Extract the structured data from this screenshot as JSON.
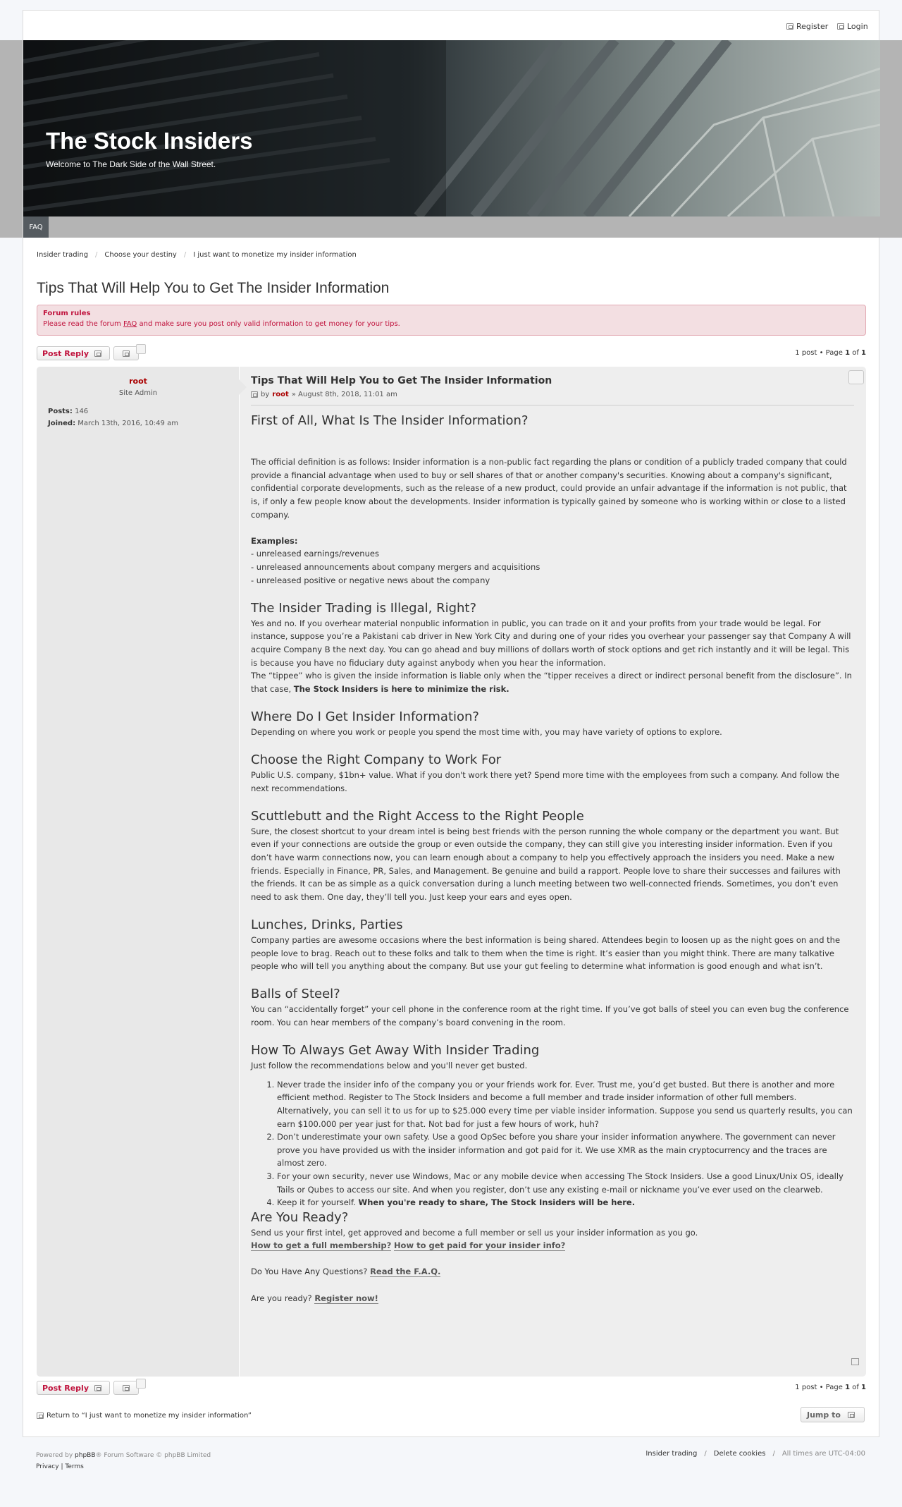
{
  "topbar": {
    "register": "Register",
    "login": "Login"
  },
  "header": {
    "title": "The Stock Insiders",
    "tagline": "Welcome to The Dark Side of the Wall Street."
  },
  "nav": {
    "faq": "FAQ"
  },
  "breadcrumbs": [
    "Insider trading",
    "Choose your destiny",
    "I just want to monetize my insider information"
  ],
  "topic_title": "Tips That Will Help You to Get The Insider Information",
  "rules": {
    "title": "Forum rules",
    "text_before": "Please read the forum ",
    "faq_link": "FAQ",
    "text_after": " and make sure you post only valid information to get money for your tips."
  },
  "actions": {
    "post_reply": "Post Reply",
    "pagination_prefix": "1 post • Page ",
    "page_current": "1",
    "pagination_of": " of ",
    "page_total": "1"
  },
  "profile": {
    "username": "root",
    "rank": "Site Admin",
    "posts_label": "Posts:",
    "posts_value": "146",
    "joined_label": "Joined:",
    "joined_value": "March 13th, 2016, 10:49 am"
  },
  "post": {
    "title": "Tips That Will Help You to Get The Insider Information",
    "meta_by": "by",
    "meta_author": "root",
    "meta_date": "» August 8th, 2018, 11:01 am",
    "h_what": "First of All, What Is The Insider Information?",
    "p_definition": "The official definition is as follows: Insider information is a non-public fact regarding the plans or condition of a publicly traded company that could provide a financial advantage when used to buy or sell shares of that or another company's securities. Knowing about a company's significant, confidential corporate developments, such as the release of a new product, could provide an unfair advantage if the information is not public, that is, if only a few people know about the developments. Insider information is typically gained by someone who is working within or close to a listed company.",
    "examples_label": "Examples:",
    "examples": [
      "- unreleased earnings/revenues",
      "- unreleased announcements about company mergers and acquisitions",
      "- unreleased positive or negative news about the company"
    ],
    "h_illegal": "The Insider Trading is Illegal, Right?",
    "p_illegal": "Yes and no. If you overhear material nonpublic information in public, you can trade on it and your profits from your trade would be legal. For instance, suppose you’re a Pakistani cab driver in New York City and during one of your rides you overhear your passenger say that Company A will acquire Company B the next day. You can go ahead and buy millions of dollars worth of stock options and get rich instantly and it will be legal. This is because you have no fiduciary duty against anybody when you hear the information.",
    "p_tippee": "The “tippee” who is given the inside information is liable only when the “tipper receives a direct or indirect personal benefit from the disclosure”. In that case, ",
    "p_tippee_bold": "The Stock Insiders is here to minimize the risk.",
    "h_where": "Where Do I Get Insider Information?",
    "p_where": "Depending on where you work or people you spend the most time with, you may have variety of options to explore.",
    "h_company": "Choose the Right Company to Work For",
    "p_company": "Public U.S. company, $1bn+ value. What if you don't work there yet? Spend more time with the employees from such a company. And follow the next recommendations.",
    "h_scuttlebutt": "Scuttlebutt and the Right Access to the Right People",
    "p_scuttlebutt": "Sure, the closest shortcut to your dream intel is being best friends with the person running the whole company or the department you want. But even if your connections are outside the group or even outside the company, they can still give you interesting insider information. Even if you don’t have warm connections now, you can learn enough about a company to help you effectively approach the insiders you need. Make a new friends. Especially in Finance, PR, Sales, and Management. Be genuine and build a rapport. People love to share their successes and failures with the friends. It can be as simple as a quick conversation during a lunch meeting between two well-connected friends. Sometimes, you don’t even need to ask them. One day, they’ll tell you. Just keep your ears and eyes open.",
    "h_lunches": "Lunches, Drinks, Parties",
    "p_lunches": "Company parties are awesome occasions where the best information is being shared. Attendees begin to loosen up as the night goes on and the people love to brag. Reach out to these folks and talk to them when the time is right. It’s easier than you might think. There are many talkative people who will tell you anything about the company. But use your gut feeling to determine what information is good enough and what isn’t.",
    "h_steel": "Balls of Steel?",
    "p_steel": "You can “accidentally forget” your cell phone in the conference room at the right time. If you’ve got balls of steel you can even bug the conference room. You can hear members of the company’s board convening in the room.",
    "h_away": "How To Always Get Away With Insider Trading",
    "p_away": "Just follow the recommendations below and you'll never get busted.",
    "list1": "Never trade the insider info of the company you or your friends work for. Ever. Trust me, you’d get busted. But there is another and more efficient method. Register to The Stock Insiders and become a full member and trade insider information of other full members.",
    "list1b": "Alternatively, you can sell it to us for up to $25.000 every time per viable insider information. Suppose you send us quarterly results, you can earn $100.000 per year just for that. Not bad for just a few hours of work, huh?",
    "list2": "Don’t underestimate your own safety. Use a good OpSec before you share your insider information anywhere. The government can never prove you have provided us with the insider information and got paid for it. We use XMR as the main cryptocurrency and the traces are almost zero.",
    "list3": "For your own security, never use Windows, Mac or any mobile device when accessing The Stock Insiders. Use a good Linux/Unix OS, ideally Tails or Qubes to access our site. And when you register, don’t use any existing e-mail or nickname you’ve ever used on the clearweb.",
    "list4": "Keep it for yourself. ",
    "list4_bold": "When you're ready to share, The Stock Insiders will be here.",
    "h_ready": "Are You Ready?",
    "p_ready": "Send us your first intel, get approved and become a full member or sell us your insider information as you go.",
    "link_membership": "How to get a full membership?",
    "link_paid": "How to get paid for your insider info?",
    "p_questions": "Do You Have Any Questions? ",
    "link_faq": "Read the F.A.Q.",
    "p_register": "Are you ready? ",
    "link_register": "Register now!"
  },
  "bottom": {
    "return_text": "Return to “I just want to monetize my insider information”",
    "jump_to": "Jump to"
  },
  "footer": {
    "powered_prefix": "Powered by ",
    "powered_brand": "phpBB",
    "powered_suffix": "® Forum Software © phpBB Limited",
    "privacy": "Privacy",
    "terms": "Terms",
    "links": [
      "Insider trading",
      "Delete cookies"
    ],
    "timezone": "All times are UTC-04:00"
  },
  "colors": {
    "accent": "#c0133d",
    "author": "#aa0000",
    "rules_bg": "#f3dfe2",
    "nav": "#b4b4b4"
  }
}
